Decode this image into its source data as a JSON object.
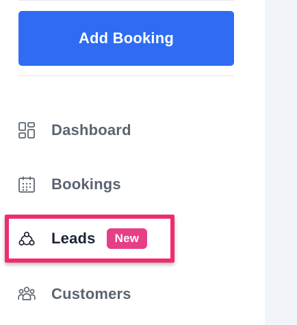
{
  "sidebar": {
    "add_booking_label": "Add Booking",
    "items": [
      {
        "id": "dashboard",
        "label": "Dashboard",
        "icon": "dashboard-grid-icon"
      },
      {
        "id": "bookings",
        "label": "Bookings",
        "icon": "calendar-icon"
      },
      {
        "id": "leads",
        "label": "Leads",
        "icon": "leads-network-icon",
        "badge": "New",
        "active": true
      },
      {
        "id": "customers",
        "label": "Customers",
        "icon": "customers-group-icon"
      }
    ]
  },
  "colors": {
    "primary_button": "#2f6cf3",
    "badge_new": "#e63f86",
    "highlight_outline": "#ef2d6e",
    "nav_text": "#5b6470",
    "nav_text_active": "#1b2333",
    "main_background": "#f1f4f9"
  }
}
